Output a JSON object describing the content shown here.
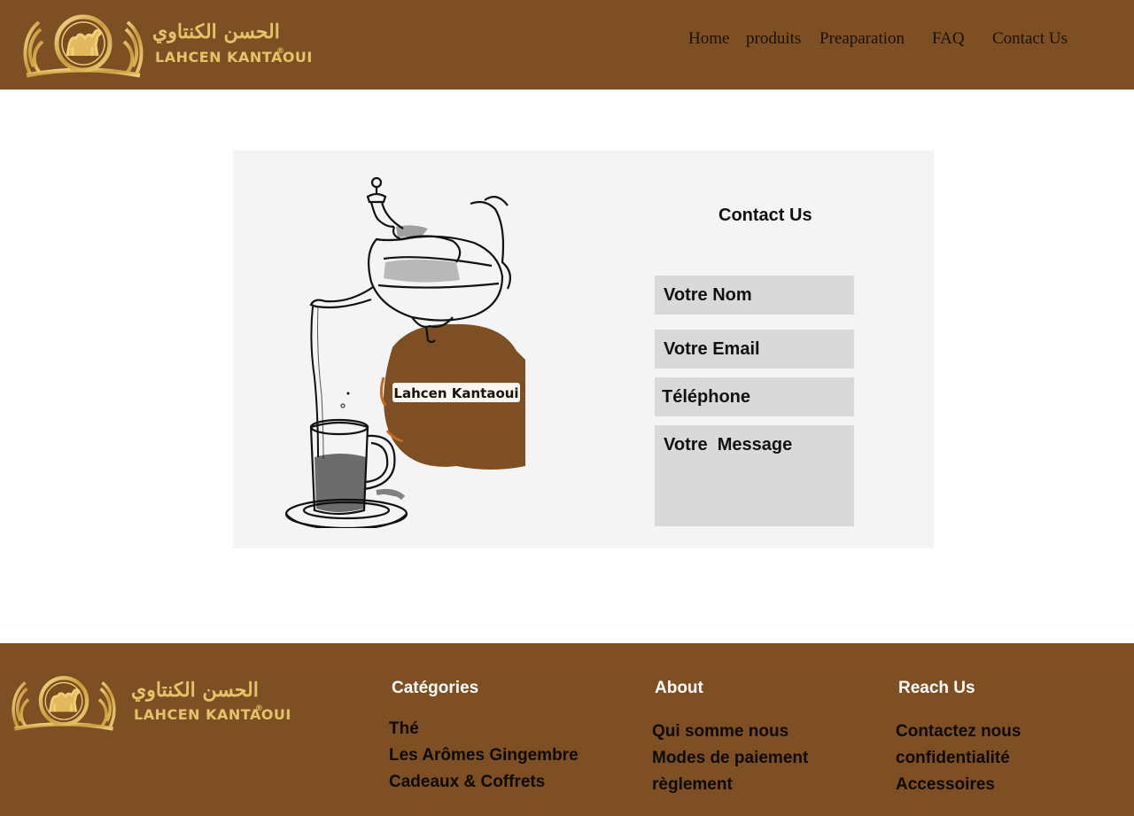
{
  "brand": {
    "arabic_name": "الحسن الكنتاوي",
    "latin_name": "LAHCEN KANTAOUI",
    "registered_mark": "®",
    "colors": {
      "primary_brown": "#7d4f22",
      "gold": "#e8c26a",
      "card_bg": "#f4f4f4",
      "field_bg": "#d9d9d9"
    }
  },
  "nav": {
    "items": [
      {
        "label": "Home"
      },
      {
        "label": "produits"
      },
      {
        "label": "Preaparation"
      },
      {
        "label": "FAQ"
      },
      {
        "label": "Contact Us"
      }
    ]
  },
  "illustration": {
    "badge_text": "Lahcen Kantaoui",
    "icon": "teapot-pouring-tea-icon"
  },
  "contact_form": {
    "title": "Contact Us",
    "name_placeholder": "Votre Nom",
    "email_placeholder": "Votre Email",
    "phone_placeholder": "Téléphone",
    "message_placeholder": "Votre  Message"
  },
  "footer": {
    "categories": {
      "title": "Catégories",
      "items": [
        "Thé",
        "Les Arômes Gingembre",
        "Cadeaux & Coffrets"
      ]
    },
    "about": {
      "title": "About",
      "items": [
        "Qui somme nous",
        "Modes de paiement",
        "règlement"
      ]
    },
    "reach": {
      "title": "Reach Us",
      "items": [
        "Contactez nous",
        "confidentialité",
        "Accessoires"
      ]
    }
  }
}
